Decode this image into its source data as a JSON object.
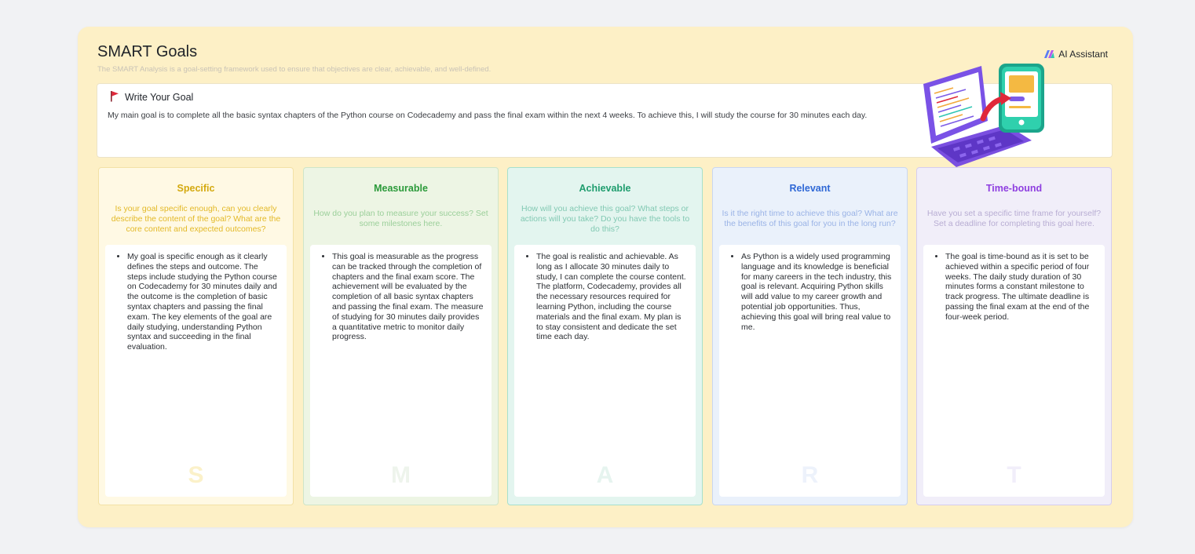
{
  "header": {
    "title": "SMART Goals",
    "subtitle": "The SMART Analysis is a goal-setting framework used to ensure that objectives are clear, achievable, and well-defined.",
    "ai_button_label": "AI Assistant"
  },
  "goal": {
    "heading": "Write Your Goal",
    "text": "My main goal is to complete all the basic syntax chapters of the Python course on Codecademy and pass the final exam within the next 4 weeks. To achieve this, I will study the course for 30 minutes each day."
  },
  "columns": [
    {
      "title": "Specific",
      "prompt": "Is your goal specific enough, can you clearly describe the content of the goal? What are the core content and expected outcomes?",
      "answer": "My goal is specific enough as it clearly defines the steps and outcome. The steps include studying the Python course on Codecademy for 30 minutes daily and the outcome is the completion of basic syntax chapters and passing the final exam. The key elements of the goal are daily studying, understanding Python syntax and succeeding in the final evaluation.",
      "letter": "S"
    },
    {
      "title": "Measurable",
      "prompt": "How do you plan to measure your success? Set some milestones here.",
      "answer": "This goal is measurable as the progress can be tracked through the completion of chapters and the final exam score. The achievement will be evaluated by the completion of all basic syntax chapters and passing the final exam. The measure of studying for 30 minutes daily provides a quantitative metric to monitor daily progress.",
      "letter": "M"
    },
    {
      "title": "Achievable",
      "prompt": "How will you achieve this goal? What steps or actions will you take? Do you have the tools to do this?",
      "answer": "The goal is realistic and achievable. As long as I allocate 30 minutes daily to study, I can complete the course content. The platform, Codecademy, provides all the necessary resources required for learning Python, including the course materials and the final exam. My plan is to stay consistent and dedicate the set time each day.",
      "letter": "A"
    },
    {
      "title": "Relevant",
      "prompt": "Is it the right time to achieve this goal? What are the benefits of this goal for you in the long run?",
      "answer": "As Python is a widely used programming language and its knowledge is beneficial for many careers in the tech industry, this goal is relevant. Acquiring Python skills will add value to my career growth and potential job opportunities. Thus, achieving this goal will bring real value to me.",
      "letter": "R"
    },
    {
      "title": "Time-bound",
      "prompt": "Have you set a specific time frame for yourself? Set a deadline for completing this goal here.",
      "answer": "The goal is time-bound as it is set to be achieved within a specific period of four weeks. The daily study duration of 30 minutes forms a constant milestone to track progress. The ultimate deadline is passing the final exam at the end of the four-week period.",
      "letter": "T"
    }
  ],
  "icons": {
    "ai": "ai-logo-icon",
    "flag": "red-flag-icon",
    "illustration": "laptop-phone-illustration"
  },
  "colors": {
    "board_bg": "#fdf0c6",
    "flag": "#e0283a"
  }
}
